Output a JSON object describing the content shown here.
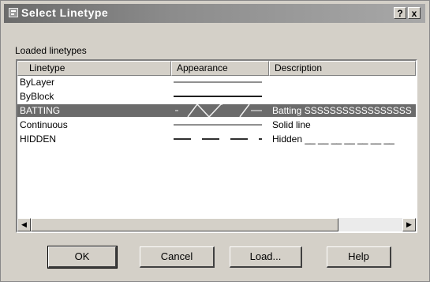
{
  "window": {
    "title": "Select Linetype",
    "help_glyph": "?",
    "close_glyph": "x"
  },
  "list": {
    "group_label": "Loaded linetypes",
    "columns": {
      "linetype": "Linetype",
      "appearance": "Appearance",
      "description": "Description"
    },
    "rows": [
      {
        "name": "ByLayer",
        "description": "",
        "pattern": "solid",
        "selected": false
      },
      {
        "name": "ByBlock",
        "description": "",
        "pattern": "solid",
        "selected": false
      },
      {
        "name": "BATTING",
        "description": "Batting SSSSSSSSSSSSSSSSS",
        "pattern": "batting",
        "selected": true
      },
      {
        "name": "Continuous",
        "description": "Solid line",
        "pattern": "solid",
        "selected": false
      },
      {
        "name": "HIDDEN",
        "description": "Hidden __ __ __ __ __ __ __",
        "pattern": "dashed",
        "selected": false
      }
    ],
    "scroll_left_glyph": "◀",
    "scroll_right_glyph": "▶"
  },
  "buttons": {
    "ok": "OK",
    "cancel": "Cancel",
    "load": "Load...",
    "help": "Help"
  },
  "colors": {
    "selection": "#6b6b6b",
    "face": "#d4d0c8",
    "title_bar": "#7a7a7a"
  }
}
